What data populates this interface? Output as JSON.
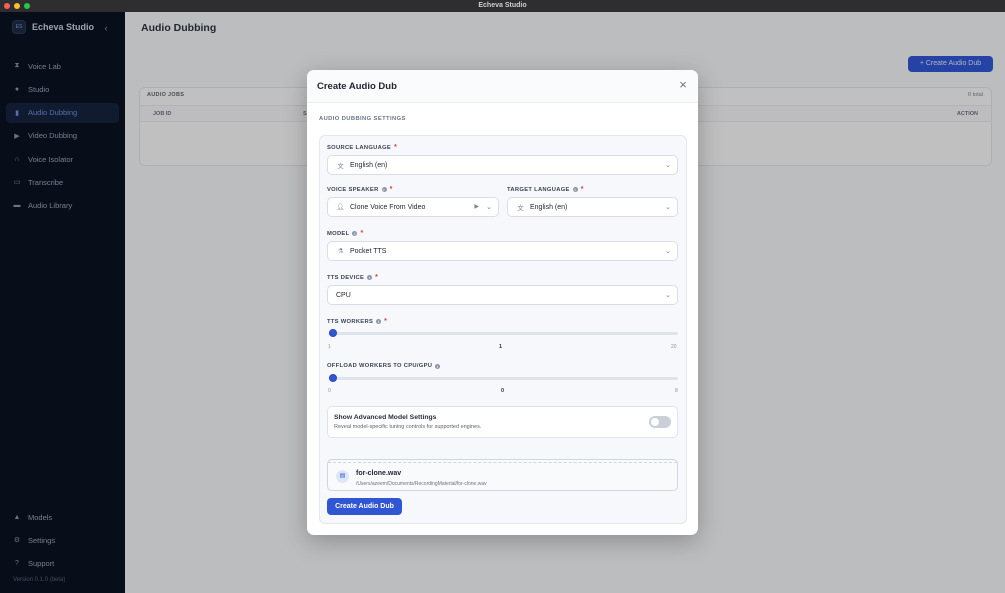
{
  "window": {
    "title": "Echeva Studio"
  },
  "sidebar": {
    "brand": "Echeva Studio",
    "logo_text": "ES",
    "items": [
      {
        "label": "Voice Lab",
        "icon": "hourglass-icon"
      },
      {
        "label": "Studio",
        "icon": "microphone-icon"
      },
      {
        "label": "Audio Dubbing",
        "icon": "document-icon",
        "active": true
      },
      {
        "label": "Video Dubbing",
        "icon": "video-icon"
      },
      {
        "label": "Voice Isolator",
        "icon": "headphones-icon"
      },
      {
        "label": "Transcribe",
        "icon": "caption-icon"
      },
      {
        "label": "Audio Library",
        "icon": "folder-icon"
      }
    ],
    "bottom_items": [
      {
        "label": "Models",
        "icon": "flask-icon"
      },
      {
        "label": "Settings",
        "icon": "gear-icon"
      },
      {
        "label": "Support",
        "icon": "help-icon"
      }
    ],
    "version": "Version 0.1.0 (beta)"
  },
  "main": {
    "title": "Audio Dubbing",
    "create_button": "+ Create Audio Dub",
    "jobs": {
      "title": "AUDIO JOBS",
      "total": "0 total",
      "columns": [
        "JOB ID",
        "S",
        "ACTION"
      ]
    }
  },
  "modal": {
    "title": "Create Audio Dub",
    "section_title": "AUDIO DUBBING SETTINGS",
    "source_language": {
      "label": "SOURCE LANGUAGE",
      "value": "English (en)"
    },
    "voice_speaker": {
      "label": "VOICE SPEAKER",
      "value": "Clone Voice From Video"
    },
    "target_language": {
      "label": "TARGET LANGUAGE",
      "value": "English (en)"
    },
    "model": {
      "label": "MODEL",
      "value": "Pocket TTS"
    },
    "tts_device": {
      "label": "TTS DEVICE",
      "value": "CPU"
    },
    "tts_workers": {
      "label": "TTS WORKERS",
      "min": "1",
      "value": "1",
      "max": "20",
      "fraction": 0
    },
    "offload_workers": {
      "label": "OFFLOAD WORKERS TO CPU/GPU",
      "min": "0",
      "value": "0",
      "max": "8",
      "fraction": 0
    },
    "advanced": {
      "title": "Show Advanced Model Settings",
      "description": "Reveal model-specific tuning controls for supported engines.",
      "enabled": false
    },
    "file": {
      "name": "for-clone.wav",
      "path": "/Users/azeem/Documents/RecordingMaterial/for-clone.wav"
    },
    "submit": "Create Audio Dub",
    "required_mark": "*"
  },
  "colors": {
    "accent": "#3056d3",
    "sidebar_bg": "#0b1220",
    "required": "#e0333b"
  }
}
